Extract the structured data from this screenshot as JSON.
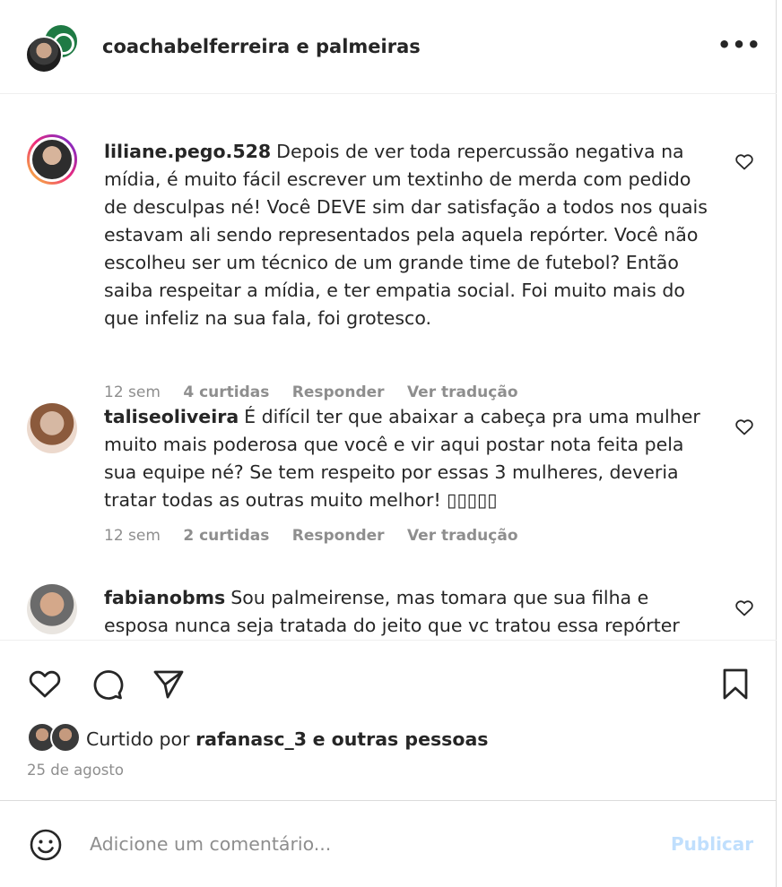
{
  "header": {
    "owner_text": "coachabelferreira e palmeiras",
    "more_label": "•••"
  },
  "comments": [
    {
      "username": "liliane.pego.528",
      "text": "Depois de ver toda repercussão negativa na mídia, é muito fácil escrever um textinho de merda com pedido de desculpas né! Você DEVE sim dar satisfação a todos nos quais estavam ali sendo representados pela aquela repórter. Você não escolheu ser um técnico de um grande time de futebol? Então saiba respeitar a mídia, e ter empatia social. Foi muito mais do que infeliz na sua fala, foi grotesco.",
      "time": "12 sem",
      "likes": "4 curtidas",
      "reply": "Responder",
      "translate": "Ver tradução"
    },
    {
      "username": "taliseoliveira",
      "text": "É difícil ter que abaixar a cabeça pra uma mulher muito mais poderosa que você e vir aqui postar nota feita pela sua equipe né? Se tem respeito por essas 3 mulheres, deveria tratar todas as outras muito melhor! ▯▯▯▯▯",
      "time": "12 sem",
      "likes": "2 curtidas",
      "reply": "Responder",
      "translate": "Ver tradução"
    },
    {
      "username": "fabianobms",
      "text": "Sou palmeirense, mas tomara que sua filha e esposa nunca seja tratada do jeito que vc tratou essa repórter"
    }
  ],
  "liked": {
    "prefix": "Curtido por",
    "user": "rafanasc_3",
    "suffix": "e outras pessoas"
  },
  "date": "25 de agosto",
  "input": {
    "placeholder": "Adicione um comentário...",
    "publish_label": "Publicar"
  },
  "colors": {
    "text": "#262626",
    "muted": "#8e8e8e",
    "publish_disabled": "#c0dffd",
    "club_green": "#1f7a44"
  }
}
